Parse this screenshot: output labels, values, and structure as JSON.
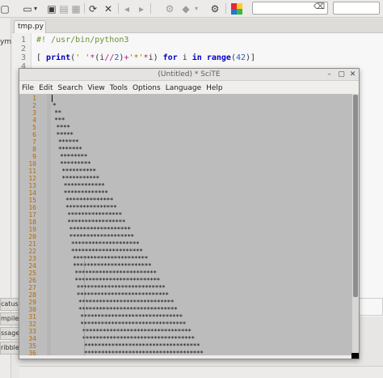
{
  "bg_window": {
    "tab": "tmp.py",
    "search_clear_icon": "clear-entry-icon",
    "sidebar_fragment": "ym",
    "line_numbers": [
      "1",
      "2",
      "3",
      "4"
    ],
    "code_line1": "#! /usr/bin/python3",
    "code_line3": "[ print(' '*(i//2)+'*'*i) for i in range(42)]",
    "message_tabs": [
      "catus",
      "mpiler",
      "ssages",
      "ribble"
    ]
  },
  "scite": {
    "title": "(Untitled) * SciTE",
    "controls": [
      "–",
      "▢",
      "✕"
    ],
    "menu": [
      "File",
      "Edit",
      "Search",
      "View",
      "Tools",
      "Options",
      "Language",
      "Help"
    ],
    "rows": 36
  }
}
